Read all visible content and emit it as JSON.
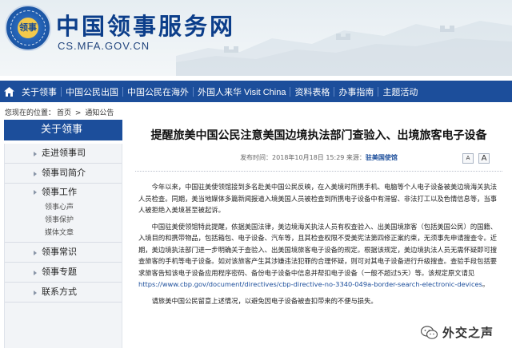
{
  "header": {
    "emblem_text": "领事",
    "title": "中国领事服务网",
    "domain": "CS.MFA.GOV.CN"
  },
  "nav": {
    "items": [
      "关于领事",
      "中国公民出国",
      "中国公民在海外",
      "外国人来华 Visit China",
      "资料表格",
      "办事指南",
      "主题活动"
    ]
  },
  "breadcrumb": {
    "prefix": "您现在的位置：",
    "home": "首页",
    "sep": ">",
    "current": "通知公告"
  },
  "sidebar": {
    "heading": "关于领事",
    "items": [
      "走进领事司",
      "领事司简介"
    ],
    "group": {
      "title": "领事工作",
      "subs": [
        "领事心声",
        "领事保护",
        "媒体文章"
      ]
    },
    "items_after": [
      "领事常识",
      "领事专题",
      "联系方式"
    ]
  },
  "article": {
    "title": "提醒旅美中国公民注意美国边境执法部门查验入、出境旅客电子设备",
    "meta_label": "发布时间：2018年10月18日 15:29 来源：",
    "source": "驻美国使馆",
    "font_small": "A",
    "font_large": "A",
    "p1": "今年以来，中国驻美使领馆接到多名赴美中国公民反映，在入美境时所携手机、电脑等个人电子设备被美边境海关执法人员检查。同期，美当地媒体多篇新闻报道入境美国人员被检查到所携电子设备中有滞留、非法打工以及色情信息等，当事人被拒绝入美境甚至被起诉。",
    "p2": "中国驻美使领馆特此提醒，依据美国法律，美边境海关执法人员有权查验入、出美国境旅客（包括美国公民）的国籍、入境目的和携带物品，包括箱包、电子设备、汽车等，且其检查权限不受美宪法第四修正案约束，无须事先申请搜查令。近期，美边境执法部门进一步明确关于查验入、出美国境旅客电子设备的规定。根据该规定，美边境执法人员无需怀疑即可搜查旅客的手机等电子设备。如对该旅客产生其涉嫌违法犯罪的合理怀疑，则可对其电子设备进行升级搜查。查验手段包括要求旅客告知该电子设备应用程序密码、备份电子设备中信息并帮扣电子设备（一般不超过5天）等。该规定原文请见",
    "p2_link": "https://www.cbp.gov/document/directives/cbp-directive-no-3340-049a-border-search-electronic-devices",
    "p2_end": "。",
    "p3": "请旅美中国公民留意上述情况，以避免因电子设备被查扣带来的不便与损失。"
  },
  "watermark": {
    "text": "外交之声"
  },
  "colors": {
    "brand_blue": "#1c4e9b",
    "title_blue": "#0c3e8a"
  }
}
